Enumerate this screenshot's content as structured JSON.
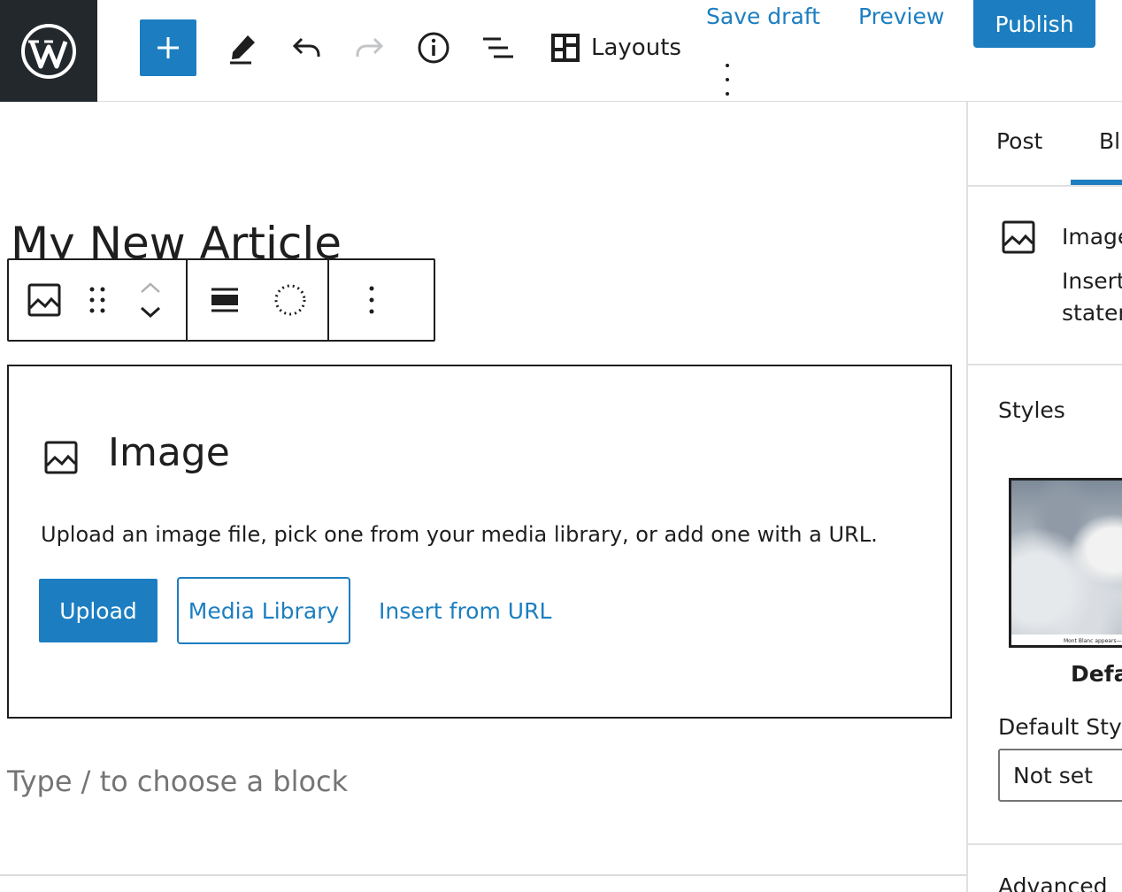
{
  "topbar": {
    "logo_icon": "wordpress-logo-icon",
    "inserter_icon": "plus-icon",
    "tools": [
      {
        "name": "edit-icon"
      },
      {
        "name": "undo-icon"
      },
      {
        "name": "redo-icon"
      },
      {
        "name": "info-icon"
      },
      {
        "name": "list-view-icon"
      }
    ],
    "layouts_label": "Layouts",
    "save_draft_label": "Save draft",
    "preview_label": "Preview",
    "publish_label": "Publish",
    "accent_color": "#1c7ec1"
  },
  "editor": {
    "post_title": "My New Article",
    "block_toolbar": {
      "icons": [
        "image-block-icon",
        "drag-handle-icon",
        "move-up-icon",
        "move-down-icon",
        "align-icon",
        "duotone-icon",
        "options-icon"
      ]
    },
    "image_block": {
      "title": "Image",
      "instructions": "Upload an image file, pick one from your media library, or add one with a URL.",
      "upload_label": "Upload",
      "media_library_label": "Media Library",
      "insert_url_label": "Insert from URL"
    },
    "appender_placeholder": "Type / to choose a block"
  },
  "sidebar": {
    "tabs": [
      {
        "label": "Post"
      },
      {
        "label": "Bl"
      }
    ],
    "block_card": {
      "title": "Image",
      "desc_line1": "Insert",
      "desc_line2": "stater"
    },
    "styles_heading": "Styles",
    "preview_caption": "Mont Blanc appears—still, s",
    "style_name": "Defa",
    "default_style_label": "Default Styl",
    "default_style_value": "Not set",
    "advanced_heading": "Advanced"
  }
}
